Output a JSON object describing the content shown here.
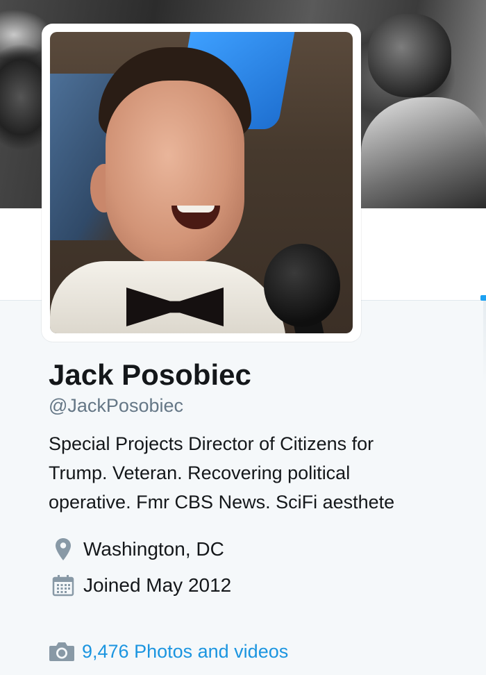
{
  "profile": {
    "name": "Jack Posobiec",
    "handle": "@JackPosobiec",
    "bio_lines": [
      "Special Projects Director of Citizens for",
      "Trump. Veteran. Recovering political",
      "operative. Fmr CBS News. SciFi aesthete"
    ],
    "location": "Washington, DC",
    "joined": "Joined May 2012",
    "photos_videos": "9,476 Photos and videos"
  },
  "icons": {
    "location": "location-pin-icon",
    "joined": "calendar-icon",
    "photos": "camera-icon"
  },
  "colors": {
    "link": "#1b95e0",
    "muted": "#657786",
    "text": "#14171a",
    "card_bg": "#f5f8fa",
    "icon_gray": "#8899a6"
  }
}
